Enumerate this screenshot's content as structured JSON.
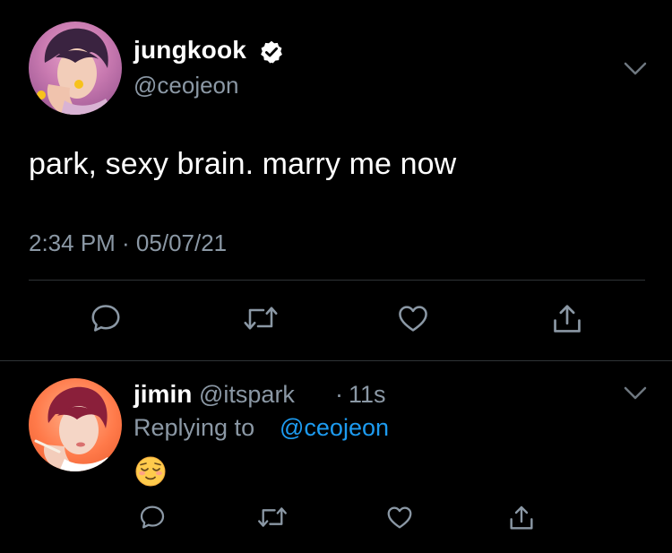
{
  "main_tweet": {
    "display_name": "jungkook",
    "handle": "@ceojeon",
    "text": "park, sexy brain. marry me now",
    "timestamp": "2:34 PM · 05/07/21",
    "verified": true,
    "avatar_icon": "profile-photo"
  },
  "reply_tweet": {
    "display_name": "jimin",
    "handle": "@itspark",
    "separator": "·",
    "time": "11s",
    "replying_label": "Replying to",
    "replying_handle": "@ceojeon",
    "emoji": "relieved-face-emoji",
    "avatar_icon": "profile-photo"
  },
  "actions": [
    "reply-icon",
    "retweet-icon",
    "like-icon",
    "share-icon"
  ],
  "colors": {
    "background": "#000000",
    "text": "#ffffff",
    "secondary": "#8b98a5",
    "link": "#1d9bf0",
    "divider": "#2f3336"
  }
}
